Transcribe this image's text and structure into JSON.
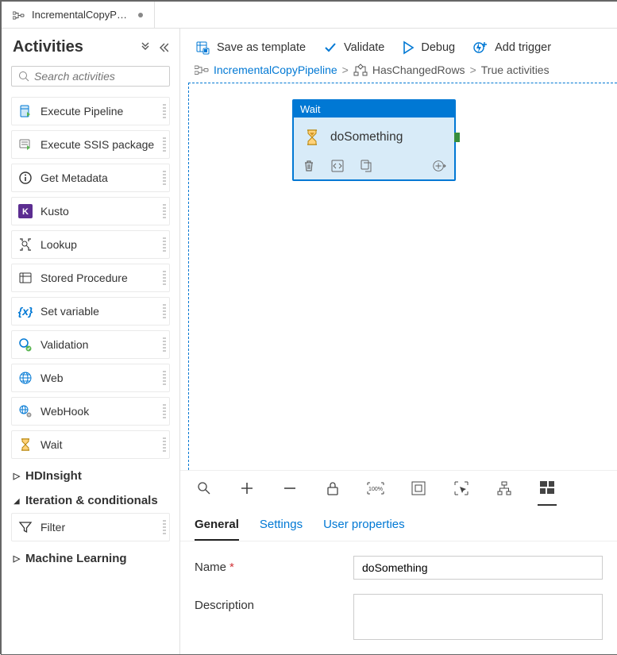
{
  "tab": {
    "title": "IncrementalCopyPip..."
  },
  "sidebar": {
    "title": "Activities",
    "search_placeholder": "Search activities",
    "items": [
      {
        "label": "Execute Pipeline"
      },
      {
        "label": "Execute SSIS package"
      },
      {
        "label": "Get Metadata"
      },
      {
        "label": "Kusto"
      },
      {
        "label": "Lookup"
      },
      {
        "label": "Stored Procedure"
      },
      {
        "label": "Set variable"
      },
      {
        "label": "Validation"
      },
      {
        "label": "Web"
      },
      {
        "label": "WebHook"
      },
      {
        "label": "Wait"
      }
    ],
    "categories": [
      {
        "label": "HDInsight",
        "expanded": false
      },
      {
        "label": "Iteration & conditionals",
        "expanded": true
      },
      {
        "label": "Machine Learning",
        "expanded": false
      }
    ],
    "filter_item": {
      "label": "Filter"
    }
  },
  "toolbar": {
    "save_template": "Save as template",
    "validate": "Validate",
    "debug": "Debug",
    "add_trigger": "Add trigger"
  },
  "breadcrumb": {
    "root": "IncrementalCopyPipeline",
    "mid": "HasChangedRows",
    "leaf": "True activities"
  },
  "node": {
    "type": "Wait",
    "title": "doSomething"
  },
  "prop_tabs": {
    "general": "General",
    "settings": "Settings",
    "user_props": "User properties"
  },
  "form": {
    "name_label": "Name",
    "name_value": "doSomething",
    "desc_label": "Description",
    "desc_value": ""
  }
}
